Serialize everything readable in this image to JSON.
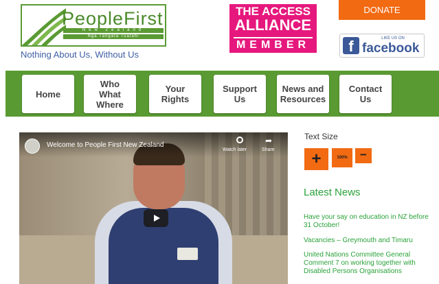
{
  "header": {
    "logo_name": "PeopleFirst",
    "logo_line1": "New Zealand",
    "logo_line2": "Ngā Tāngata Tuatahi",
    "tagline": "Nothing About Us, Without Us",
    "access_line1": "THE ACCESS",
    "access_line2": "ALLIANCE",
    "access_line3": "MEMBER",
    "donate_label": "DONATE",
    "facebook_like": "LIKE US ON",
    "facebook_text": "facebook",
    "facebook_f": "f"
  },
  "nav": {
    "items": [
      {
        "label": "Home"
      },
      {
        "label": "Who What Where"
      },
      {
        "label": "Your Rights"
      },
      {
        "label": "Support Us"
      },
      {
        "label": "News and Resources"
      },
      {
        "label": "Contact Us"
      }
    ]
  },
  "video": {
    "title": "Welcome to People First New Zealand",
    "watch_later": "Watch later",
    "share": "Share"
  },
  "sidebar": {
    "text_size_label": "Text Size",
    "plus": "+",
    "reset": "100%",
    "minus": "−",
    "latest_news_title": "Latest News",
    "news_items": [
      "Have your say on education in NZ before 31 October!",
      "Vacancies – Greymouth and Timaru",
      "United Nations Committee General Comment 7 on working together with Disabled Persons Organisations"
    ]
  },
  "colors": {
    "brand_green": "#5a9a33",
    "news_green": "#2aa23a",
    "accent_orange": "#f26a12",
    "access_pink": "#e6187d",
    "facebook_blue": "#3b5998"
  }
}
